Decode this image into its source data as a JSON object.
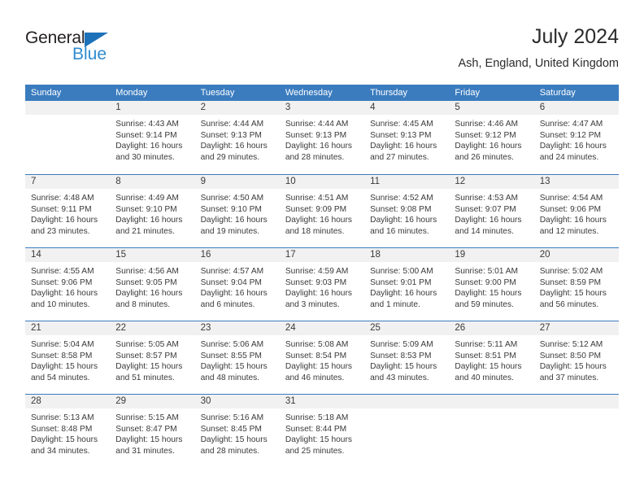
{
  "logo": {
    "line1": "General",
    "line2": "Blue",
    "triangle_icon": "triangle-icon",
    "color_dark": "#231f20",
    "color_blue": "#2e8bd0"
  },
  "header": {
    "month_title": "July 2024",
    "location": "Ash, England, United Kingdom"
  },
  "colors": {
    "header_bar": "#3b7cbf",
    "daynum_band": "#f1f1f1",
    "text": "#3a3a3a"
  },
  "calendar": {
    "weekday_headers": [
      "Sunday",
      "Monday",
      "Tuesday",
      "Wednesday",
      "Thursday",
      "Friday",
      "Saturday"
    ],
    "weeks": [
      [
        {
          "day": "",
          "lines": []
        },
        {
          "day": "1",
          "lines": [
            "Sunrise: 4:43 AM",
            "Sunset: 9:14 PM",
            "Daylight: 16 hours",
            "and 30 minutes."
          ]
        },
        {
          "day": "2",
          "lines": [
            "Sunrise: 4:44 AM",
            "Sunset: 9:13 PM",
            "Daylight: 16 hours",
            "and 29 minutes."
          ]
        },
        {
          "day": "3",
          "lines": [
            "Sunrise: 4:44 AM",
            "Sunset: 9:13 PM",
            "Daylight: 16 hours",
            "and 28 minutes."
          ]
        },
        {
          "day": "4",
          "lines": [
            "Sunrise: 4:45 AM",
            "Sunset: 9:13 PM",
            "Daylight: 16 hours",
            "and 27 minutes."
          ]
        },
        {
          "day": "5",
          "lines": [
            "Sunrise: 4:46 AM",
            "Sunset: 9:12 PM",
            "Daylight: 16 hours",
            "and 26 minutes."
          ]
        },
        {
          "day": "6",
          "lines": [
            "Sunrise: 4:47 AM",
            "Sunset: 9:12 PM",
            "Daylight: 16 hours",
            "and 24 minutes."
          ]
        }
      ],
      [
        {
          "day": "7",
          "lines": [
            "Sunrise: 4:48 AM",
            "Sunset: 9:11 PM",
            "Daylight: 16 hours",
            "and 23 minutes."
          ]
        },
        {
          "day": "8",
          "lines": [
            "Sunrise: 4:49 AM",
            "Sunset: 9:10 PM",
            "Daylight: 16 hours",
            "and 21 minutes."
          ]
        },
        {
          "day": "9",
          "lines": [
            "Sunrise: 4:50 AM",
            "Sunset: 9:10 PM",
            "Daylight: 16 hours",
            "and 19 minutes."
          ]
        },
        {
          "day": "10",
          "lines": [
            "Sunrise: 4:51 AM",
            "Sunset: 9:09 PM",
            "Daylight: 16 hours",
            "and 18 minutes."
          ]
        },
        {
          "day": "11",
          "lines": [
            "Sunrise: 4:52 AM",
            "Sunset: 9:08 PM",
            "Daylight: 16 hours",
            "and 16 minutes."
          ]
        },
        {
          "day": "12",
          "lines": [
            "Sunrise: 4:53 AM",
            "Sunset: 9:07 PM",
            "Daylight: 16 hours",
            "and 14 minutes."
          ]
        },
        {
          "day": "13",
          "lines": [
            "Sunrise: 4:54 AM",
            "Sunset: 9:06 PM",
            "Daylight: 16 hours",
            "and 12 minutes."
          ]
        }
      ],
      [
        {
          "day": "14",
          "lines": [
            "Sunrise: 4:55 AM",
            "Sunset: 9:06 PM",
            "Daylight: 16 hours",
            "and 10 minutes."
          ]
        },
        {
          "day": "15",
          "lines": [
            "Sunrise: 4:56 AM",
            "Sunset: 9:05 PM",
            "Daylight: 16 hours",
            "and 8 minutes."
          ]
        },
        {
          "day": "16",
          "lines": [
            "Sunrise: 4:57 AM",
            "Sunset: 9:04 PM",
            "Daylight: 16 hours",
            "and 6 minutes."
          ]
        },
        {
          "day": "17",
          "lines": [
            "Sunrise: 4:59 AM",
            "Sunset: 9:03 PM",
            "Daylight: 16 hours",
            "and 3 minutes."
          ]
        },
        {
          "day": "18",
          "lines": [
            "Sunrise: 5:00 AM",
            "Sunset: 9:01 PM",
            "Daylight: 16 hours",
            "and 1 minute."
          ]
        },
        {
          "day": "19",
          "lines": [
            "Sunrise: 5:01 AM",
            "Sunset: 9:00 PM",
            "Daylight: 15 hours",
            "and 59 minutes."
          ]
        },
        {
          "day": "20",
          "lines": [
            "Sunrise: 5:02 AM",
            "Sunset: 8:59 PM",
            "Daylight: 15 hours",
            "and 56 minutes."
          ]
        }
      ],
      [
        {
          "day": "21",
          "lines": [
            "Sunrise: 5:04 AM",
            "Sunset: 8:58 PM",
            "Daylight: 15 hours",
            "and 54 minutes."
          ]
        },
        {
          "day": "22",
          "lines": [
            "Sunrise: 5:05 AM",
            "Sunset: 8:57 PM",
            "Daylight: 15 hours",
            "and 51 minutes."
          ]
        },
        {
          "day": "23",
          "lines": [
            "Sunrise: 5:06 AM",
            "Sunset: 8:55 PM",
            "Daylight: 15 hours",
            "and 48 minutes."
          ]
        },
        {
          "day": "24",
          "lines": [
            "Sunrise: 5:08 AM",
            "Sunset: 8:54 PM",
            "Daylight: 15 hours",
            "and 46 minutes."
          ]
        },
        {
          "day": "25",
          "lines": [
            "Sunrise: 5:09 AM",
            "Sunset: 8:53 PM",
            "Daylight: 15 hours",
            "and 43 minutes."
          ]
        },
        {
          "day": "26",
          "lines": [
            "Sunrise: 5:11 AM",
            "Sunset: 8:51 PM",
            "Daylight: 15 hours",
            "and 40 minutes."
          ]
        },
        {
          "day": "27",
          "lines": [
            "Sunrise: 5:12 AM",
            "Sunset: 8:50 PM",
            "Daylight: 15 hours",
            "and 37 minutes."
          ]
        }
      ],
      [
        {
          "day": "28",
          "lines": [
            "Sunrise: 5:13 AM",
            "Sunset: 8:48 PM",
            "Daylight: 15 hours",
            "and 34 minutes."
          ]
        },
        {
          "day": "29",
          "lines": [
            "Sunrise: 5:15 AM",
            "Sunset: 8:47 PM",
            "Daylight: 15 hours",
            "and 31 minutes."
          ]
        },
        {
          "day": "30",
          "lines": [
            "Sunrise: 5:16 AM",
            "Sunset: 8:45 PM",
            "Daylight: 15 hours",
            "and 28 minutes."
          ]
        },
        {
          "day": "31",
          "lines": [
            "Sunrise: 5:18 AM",
            "Sunset: 8:44 PM",
            "Daylight: 15 hours",
            "and 25 minutes."
          ]
        },
        {
          "day": "",
          "lines": []
        },
        {
          "day": "",
          "lines": []
        },
        {
          "day": "",
          "lines": []
        }
      ]
    ]
  }
}
